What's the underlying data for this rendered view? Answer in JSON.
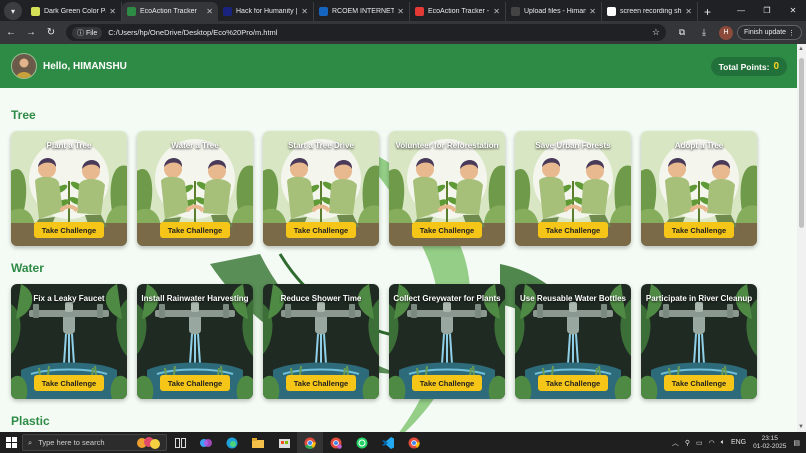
{
  "browser": {
    "tabs": [
      {
        "title": "Dark Green Color Pa",
        "color": "#d4e157",
        "active": false
      },
      {
        "title": "EcoAction Tracker",
        "color": "#2e8b46",
        "active": true
      },
      {
        "title": "Hack for Humanity |",
        "color": "#1a237e",
        "active": false
      },
      {
        "title": "RCOEM INTERNET P",
        "color": "#1565c0",
        "active": false
      },
      {
        "title": "EcoAction Tracker - Y",
        "color": "#e53935",
        "active": false
      },
      {
        "title": "Upload files - Himan",
        "color": "#444444",
        "active": false
      },
      {
        "title": "screen recording sh",
        "color": "#ffffff",
        "active": false
      }
    ],
    "address": {
      "chip": "File",
      "url": "C:/Users/hp/OneDrive/Desktop/Eco%20Pro/m.html"
    },
    "profile_initial": "H",
    "finish_update": "Finish update"
  },
  "header": {
    "greeting": "Hello, HIMANSHU",
    "points_label": "Total Points:",
    "points_value": "0"
  },
  "sections": [
    {
      "title": "Tree",
      "art": "tree",
      "cards": [
        {
          "title": "Plant a Tree",
          "button": "Take Challenge"
        },
        {
          "title": "Water a Tree",
          "button": "Take Challenge"
        },
        {
          "title": "Start a Tree Drive",
          "button": "Take Challenge"
        },
        {
          "title": "Volunteer for Reforestation",
          "button": "Take Challenge"
        },
        {
          "title": "Save Urban Forests",
          "button": "Take Challenge"
        },
        {
          "title": "Adopt a Tree",
          "button": "Take Challenge"
        }
      ]
    },
    {
      "title": "Water",
      "art": "water",
      "cards": [
        {
          "title": "Fix a Leaky Faucet",
          "button": "Take Challenge"
        },
        {
          "title": "Install Rainwater Harvesting",
          "button": "Take Challenge"
        },
        {
          "title": "Reduce Shower Time",
          "button": "Take Challenge"
        },
        {
          "title": "Collect Greywater for Plants",
          "button": "Take Challenge"
        },
        {
          "title": "Use Reusable Water Bottles",
          "button": "Take Challenge"
        },
        {
          "title": "Participate in River Cleanup",
          "button": "Take Challenge"
        }
      ]
    },
    {
      "title": "Plastic",
      "art": "",
      "cards": []
    }
  ],
  "taskbar": {
    "search_placeholder": "Type here to search",
    "language": "ENG",
    "time": "23:15",
    "date": "01-02-2025"
  },
  "colors": {
    "header_green": "#2e8b46",
    "title_green": "#2e8b46",
    "button_yellow": "#f5c518",
    "points_yellow": "#ffd21f"
  }
}
